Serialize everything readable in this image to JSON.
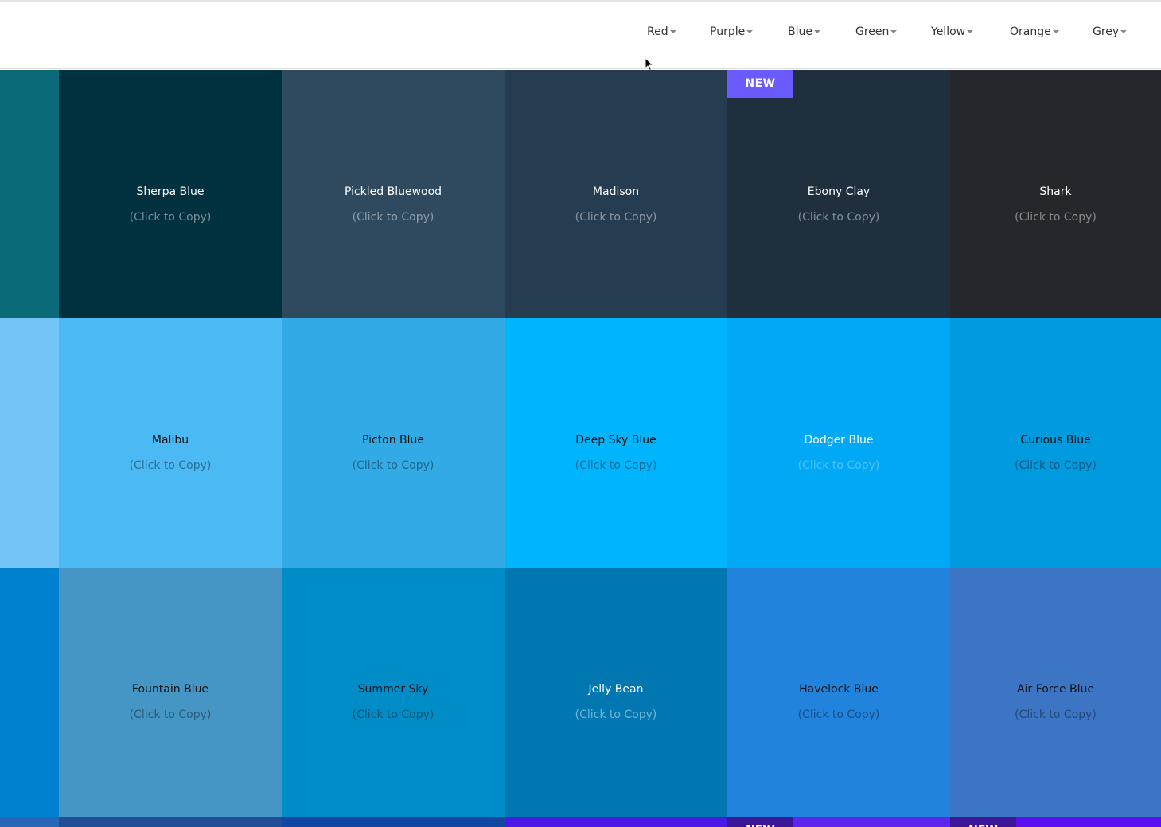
{
  "nav": {
    "items": [
      {
        "label": "Red"
      },
      {
        "label": "Purple"
      },
      {
        "label": "Blue"
      },
      {
        "label": "Green"
      },
      {
        "label": "Yellow"
      },
      {
        "label": "Orange"
      },
      {
        "label": "Grey"
      }
    ]
  },
  "copy_hint": "(Click to Copy)",
  "badge": "NEW",
  "rows": [
    {
      "edge_color": "#0b6a78",
      "cells": [
        {
          "name": "Sherpa Blue",
          "color": "#01313f"
        },
        {
          "name": "Pickled Bluewood",
          "color": "#2f4a5f"
        },
        {
          "name": "Madison",
          "color": "#263c51"
        },
        {
          "name": "Ebony Clay",
          "color": "#202f3e"
        },
        {
          "name": "Shark",
          "color": "#25272c"
        }
      ]
    },
    {
      "edge_color": "#74c3f7",
      "cells": [
        {
          "name": "Malibu",
          "color": "#4ab9f4"
        },
        {
          "name": "Picton Blue",
          "color": "#31aae6"
        },
        {
          "name": "Deep Sky Blue",
          "color": "#00b5fe"
        },
        {
          "name": "Dodger Blue",
          "color": "#00a8f5"
        },
        {
          "name": "Curious Blue",
          "color": "#009ade"
        }
      ]
    },
    {
      "edge_color": "#0081d0",
      "cells": [
        {
          "name": "Fountain Blue",
          "color": "#4596c4"
        },
        {
          "name": "Summer Sky",
          "color": "#008cc6"
        },
        {
          "name": "Jelly Bean",
          "color": "#0077b0"
        },
        {
          "name": "Havelock Blue",
          "color": "#2283dc"
        },
        {
          "name": "Air Force Blue",
          "color": "#3c75c3"
        }
      ]
    },
    {
      "edge_color": "#2866b8",
      "cells": [
        {
          "color": "#204d96"
        },
        {
          "color": "#1147a2"
        },
        {
          "color": "#4b18e8"
        },
        {
          "color": "#5b27ee"
        },
        {
          "color": "#5a0ff0"
        }
      ]
    }
  ],
  "colors": {
    "nav_text": "#333333",
    "badge_bg": "#6b5bff",
    "badge_dark_bg": "#3b1696"
  }
}
